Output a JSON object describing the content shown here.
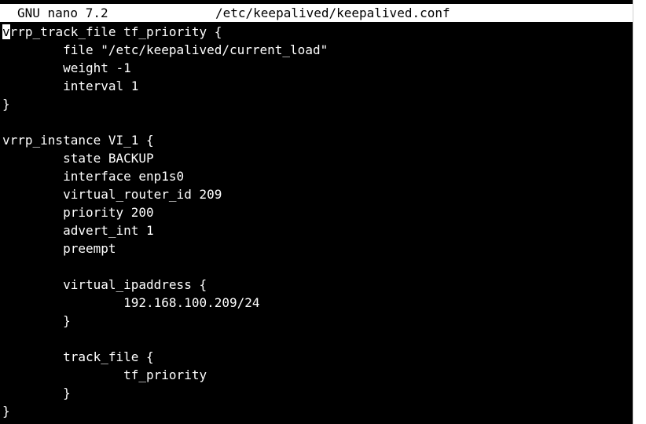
{
  "titlebar": {
    "app": "GNU nano 7.2",
    "file": "/etc/keepalived/keepalived.conf"
  },
  "editor": {
    "cursor_char": "v",
    "lines": [
      "rrp_track_file tf_priority {",
      "        file \"/etc/keepalived/current_load\"",
      "        weight -1",
      "        interval 1",
      "}",
      "",
      "vrrp_instance VI_1 {",
      "        state BACKUP",
      "        interface enp1s0",
      "        virtual_router_id 209",
      "        priority 200",
      "        advert_int 1",
      "        preempt",
      "",
      "        virtual_ipaddress {",
      "                192.168.100.209/24",
      "        }",
      "",
      "        track_file {",
      "                tf_priority",
      "        }",
      "}"
    ]
  },
  "colors": {
    "background": "#000000",
    "foreground": "#ffffff",
    "titlebar_bg": "#ffffff",
    "titlebar_fg": "#000000"
  }
}
